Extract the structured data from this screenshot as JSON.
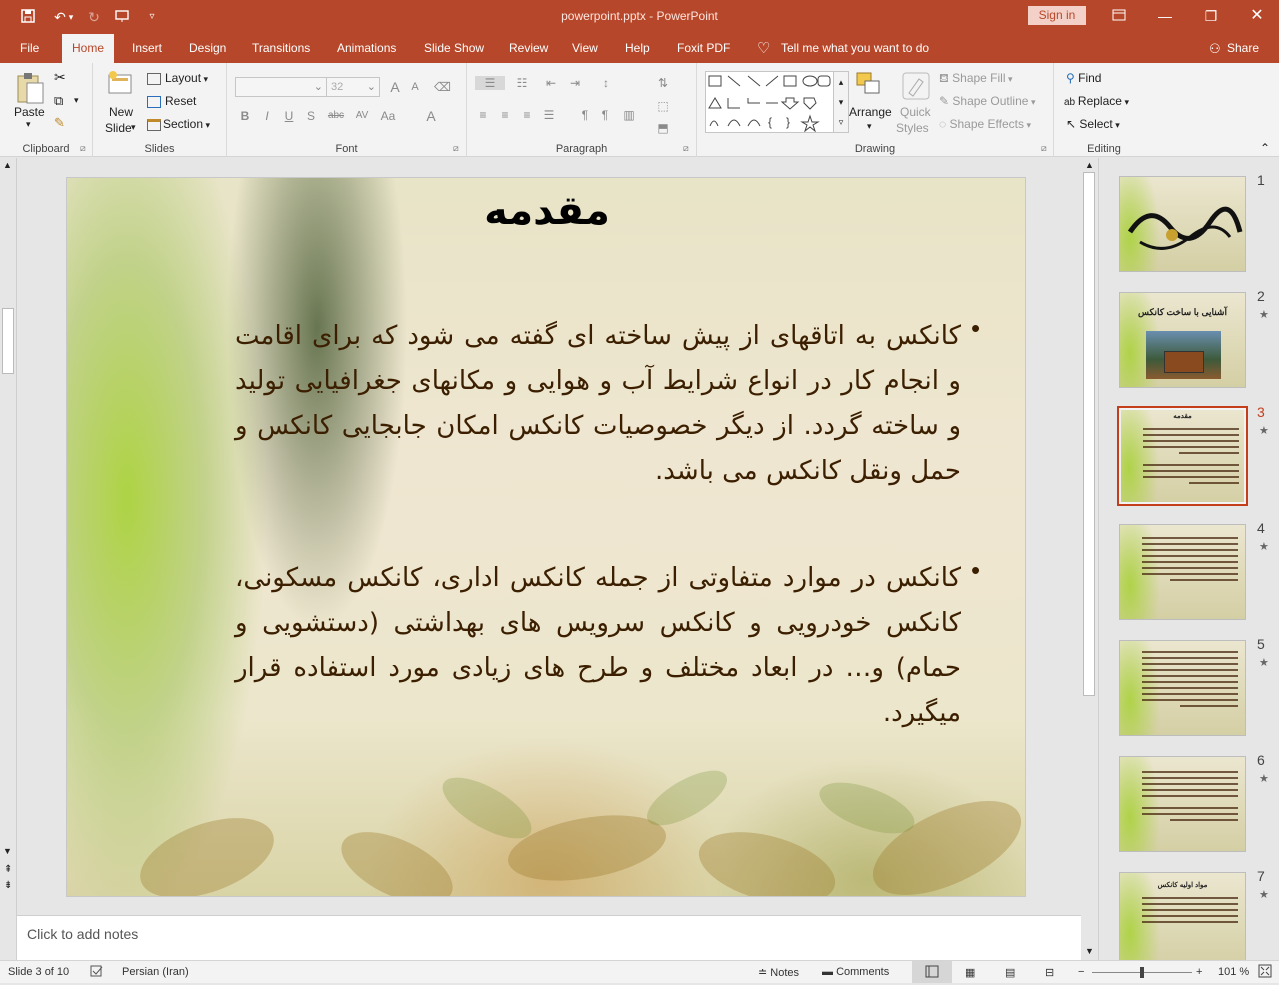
{
  "app": {
    "doc_title": "powerpoint.pptx - PowerPoint",
    "sign_in": "Sign in"
  },
  "tabs": [
    {
      "label": "File"
    },
    {
      "label": "Home"
    },
    {
      "label": "Insert"
    },
    {
      "label": "Design"
    },
    {
      "label": "Transitions"
    },
    {
      "label": "Animations"
    },
    {
      "label": "Slide Show"
    },
    {
      "label": "Review"
    },
    {
      "label": "View"
    },
    {
      "label": "Help"
    },
    {
      "label": "Foxit PDF"
    }
  ],
  "tell_me": "Tell me what you want to do",
  "share": "Share",
  "ribbon": {
    "clipboard": {
      "label": "Clipboard",
      "paste": "Paste"
    },
    "slides": {
      "label": "Slides",
      "new_slide_1": "New",
      "new_slide_2": "Slide",
      "layout": "Layout",
      "reset": "Reset",
      "section": "Section"
    },
    "font": {
      "label": "Font",
      "font_name": "",
      "font_size": "32",
      "bold": "B",
      "italic": "I",
      "underline": "U",
      "shadow": "S",
      "strike": "abc",
      "spacing": "AV",
      "case": "Aa",
      "color": "A"
    },
    "paragraph": {
      "label": "Paragraph"
    },
    "drawing": {
      "label": "Drawing",
      "arrange": "Arrange",
      "quick_styles_1": "Quick",
      "quick_styles_2": "Styles",
      "shape_fill": "Shape Fill",
      "shape_outline": "Shape Outline",
      "shape_effects": "Shape Effects"
    },
    "editing": {
      "label": "Editing",
      "find": "Find",
      "replace": "Replace",
      "select": "Select"
    }
  },
  "slide": {
    "title": "مقدمه",
    "bullets": [
      "کانکس به اتاقهای از پیش ساخته ای گفته می شود که برای اقامت و انجام کار در انواع شرایط آب و هوایی و مکانهای جغرافیایی تولید و ساخته گردد. از دیگر خصوصیات کانکس امکان جابجایی کانکس و حمل ونقل کانکس می باشد.",
      "کانکس در موارد متفاوتی از جمله کانکس اداری، کانکس مسکونی، کانکس خودرویی و کانکس سرویس های بهداشتی (دستشویی و حمام) و… در ابعاد مختلف و طرح های زیادی مورد استفاده قرار میگیرد."
    ]
  },
  "thumbnails": [
    {
      "num": "1",
      "star": "",
      "title": "",
      "selected": false
    },
    {
      "num": "2",
      "star": "★",
      "title": "آشنایی با ساخت کانکس",
      "selected": false
    },
    {
      "num": "3",
      "star": "★",
      "title": "مقدمه",
      "selected": true
    },
    {
      "num": "4",
      "star": "★",
      "title": "",
      "selected": false
    },
    {
      "num": "5",
      "star": "★",
      "title": "",
      "selected": false
    },
    {
      "num": "6",
      "star": "★",
      "title": "",
      "selected": false
    },
    {
      "num": "7",
      "star": "★",
      "title": "مواد اولیه کانکس",
      "selected": false
    }
  ],
  "notes_placeholder": "Click to add notes",
  "status": {
    "slide_info": "Slide 3 of 10",
    "language": "Persian (Iran)",
    "notes": "Notes",
    "comments": "Comments",
    "zoom": "101 %"
  },
  "colors": {
    "accent": "#b7472a",
    "slide_text": "#3b1f00"
  }
}
